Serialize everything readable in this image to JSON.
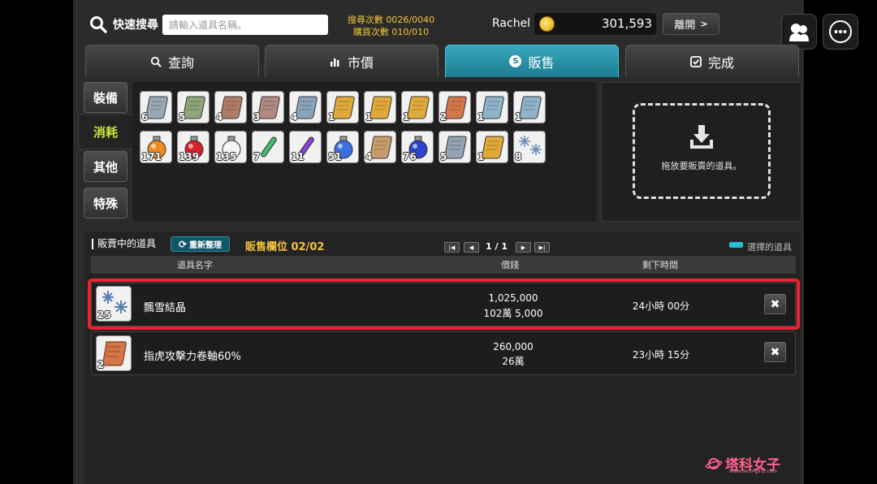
{
  "header": {
    "search_label": "快速搜尋",
    "search_placeholder": "請輸入道具名稱。",
    "search_count": "搜尋次數 0026/0040",
    "buy_count": "購買次數 010/010",
    "user_name": "Rachel",
    "coins": "301,593",
    "leave_label": "離開"
  },
  "tabs": [
    {
      "label": "查詢",
      "icon": "search-icon"
    },
    {
      "label": "市價",
      "icon": "bar-chart-icon"
    },
    {
      "label": "販售",
      "icon": "s-coin-icon",
      "active": true
    },
    {
      "label": "完成",
      "icon": "checkbox-icon"
    }
  ],
  "categories": [
    {
      "label": "裝備"
    },
    {
      "label": "消耗",
      "active": true
    },
    {
      "label": "其他"
    },
    {
      "label": "特殊"
    }
  ],
  "inventory": [
    {
      "qty": "6",
      "icon": "scroll-icon",
      "color": "#9aa7b4"
    },
    {
      "qty": "5",
      "icon": "scroll-icon",
      "color": "#8fa57a"
    },
    {
      "qty": "4",
      "icon": "scroll-icon",
      "color": "#b07c66"
    },
    {
      "qty": "3",
      "icon": "scroll-icon",
      "color": "#b08a80"
    },
    {
      "qty": "4",
      "icon": "scroll-icon",
      "color": "#8aa3b8"
    },
    {
      "qty": "1",
      "icon": "scroll-icon",
      "color": "#e0a93a"
    },
    {
      "qty": "1",
      "icon": "scroll-icon",
      "color": "#e0a93a"
    },
    {
      "qty": "1",
      "icon": "scroll-icon",
      "color": "#e0a93a"
    },
    {
      "qty": "2",
      "icon": "scroll-icon",
      "color": "#d4764a"
    },
    {
      "qty": "1",
      "icon": "scroll-icon",
      "color": "#8fb3c9"
    },
    {
      "qty": "1",
      "icon": "scroll-icon",
      "color": "#8fb3c9"
    },
    {
      "qty": "171",
      "icon": "orange-potion-icon",
      "color": "#f08a1e"
    },
    {
      "qty": "139",
      "icon": "red-potion-icon",
      "color": "#d81f2a"
    },
    {
      "qty": "135",
      "icon": "white-potion-icon",
      "color": "#f4f4f4"
    },
    {
      "qty": "7",
      "icon": "green-vial-icon",
      "color": "#3fbf6a"
    },
    {
      "qty": "11",
      "icon": "purple-vial-icon",
      "color": "#8b3fd6"
    },
    {
      "qty": "51",
      "icon": "blue-potion-icon",
      "color": "#3a6fe0"
    },
    {
      "qty": "4",
      "icon": "scroll-icon",
      "color": "#c79c6a"
    },
    {
      "qty": "76",
      "icon": "blue-potion-icon",
      "color": "#2a43c9"
    },
    {
      "qty": "5",
      "icon": "scroll-icon",
      "color": "#95a3b3"
    },
    {
      "qty": "1",
      "icon": "scroll-icon",
      "color": "#e0a93a"
    },
    {
      "qty": "8",
      "icon": "snowflake-icon",
      "color": "#6a8fb8"
    }
  ],
  "drop_zone": {
    "text": "拖放要販賣的道具。",
    "icon": "download-icon"
  },
  "listing": {
    "title": "販賣中的道具",
    "refresh_label": "重新整理",
    "slot_count": "販售欄位 02/02",
    "page": "1 / 1",
    "legend_label": "選擇的道具",
    "columns": [
      "道具名字",
      "價錢",
      "剩下時間"
    ],
    "rows": [
      {
        "qty": "25",
        "icon": "snowflake-icon",
        "name": "飄雪結晶",
        "price": "1,025,000",
        "price_cn": "102萬 5,000",
        "time": "24小時 00分",
        "selected": true
      },
      {
        "qty": "2",
        "icon": "scroll-icon",
        "name": "指虎攻擊力卷軸60%",
        "price": "260,000",
        "price_cn": "26萬",
        "time": "23小時 15分",
        "selected": false
      }
    ]
  },
  "watermark": {
    "title": "塔科女子",
    "url": "www.tech-girlz.com"
  }
}
